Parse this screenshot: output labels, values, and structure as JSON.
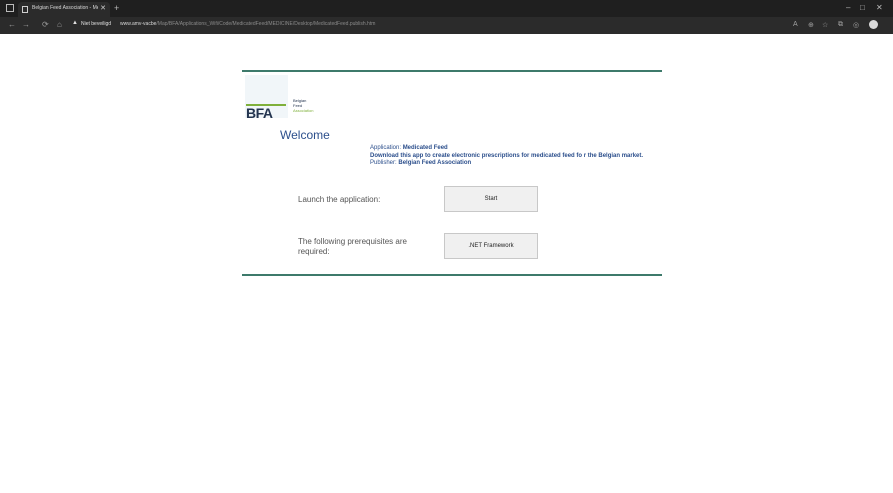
{
  "browser": {
    "tab_title": "Belgian Feed Association - Medi...",
    "tab_close": "✕",
    "new_tab": "+",
    "window_controls": [
      "–",
      "□",
      "✕"
    ],
    "nav_icons": [
      "back-icon",
      "forward-icon",
      "refresh-icon",
      "home-icon"
    ],
    "nav_glyphs": [
      "←",
      "→",
      "⟳",
      "⌂"
    ],
    "security_warning": "Niet beveiligd",
    "url_host": "www.amv-vacbe",
    "url_path": "/Map/BFA/Applications_Wifi/Code/MedicatedFeed/MEDICINE/Desktop/MedicatedFeed.publish.htm",
    "toolbar_icons": [
      "read-aloud-icon",
      "zoom-icon",
      "favorites-icon",
      "collections-icon",
      "extensions-icon",
      "profile-icon"
    ],
    "toolbar_glyphs": [
      "A",
      "⊕",
      "☆",
      "⧉",
      "◎"
    ]
  },
  "page": {
    "logo": {
      "mark": "BFA",
      "line1": "Belgian",
      "line2": "Feed",
      "line3": "Association"
    },
    "welcome": "Welcome",
    "application_label": "Application: ",
    "application_name": "Medicated Feed",
    "description": "Download this app to create electronic prescriptions for medicated feed fo r the Belgian market.",
    "publisher_label": "Publisher: ",
    "publisher_name": "Belgian Feed Association",
    "launch_label": "Launch the application:",
    "start_button": "Start",
    "prereq_label": "The following prerequisites are required:",
    "prereq_button": ".NET Framework"
  },
  "colors": {
    "accent_rule": "#3d7a6b",
    "title_blue": "#2c4f8c",
    "logo_green": "#7fb03b"
  }
}
